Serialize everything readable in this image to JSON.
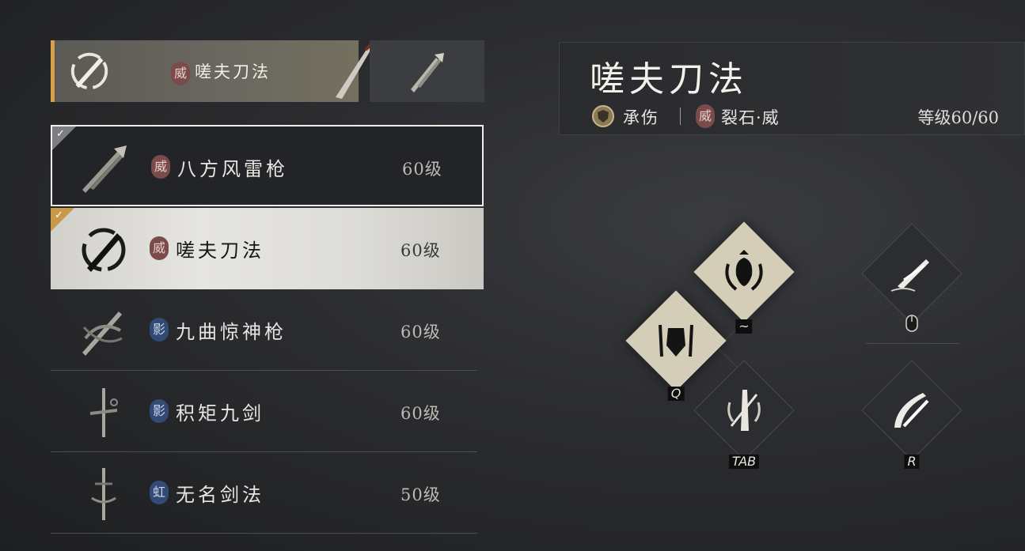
{
  "equipped": {
    "seal": "威",
    "name": "嗟夫刀法"
  },
  "list": [
    {
      "seal": "威",
      "seal_color": "#7b4a4b",
      "name": "八方风雷枪",
      "level": "60级",
      "state": "selected"
    },
    {
      "seal": "威",
      "seal_color": "#7b4a4b",
      "name": "嗟夫刀法",
      "level": "60级",
      "state": "active"
    },
    {
      "seal": "影",
      "seal_color": "#334a74",
      "name": "九曲惊神枪",
      "level": "60级",
      "state": "normal"
    },
    {
      "seal": "影",
      "seal_color": "#334a74",
      "name": "积矩九剑",
      "level": "60级",
      "state": "normal"
    },
    {
      "seal": "虹",
      "seal_color": "#334a74",
      "name": "无名剑法",
      "level": "50级",
      "state": "normal"
    }
  ],
  "detail": {
    "title": "嗟夫刀法",
    "role": "承伤",
    "seal": "威",
    "seal_text": "裂石·威",
    "level": "等级60/60"
  },
  "skills": {
    "top": {
      "key": "~"
    },
    "left": {
      "key": "Q"
    },
    "bottom": {
      "key": "TAB"
    },
    "mouse": {
      "key": ""
    },
    "right": {
      "key": "R"
    }
  },
  "colors": {
    "accent_gold": "#d6a14a",
    "seal_red": "#7b4a4b",
    "seal_blue": "#334a74"
  }
}
